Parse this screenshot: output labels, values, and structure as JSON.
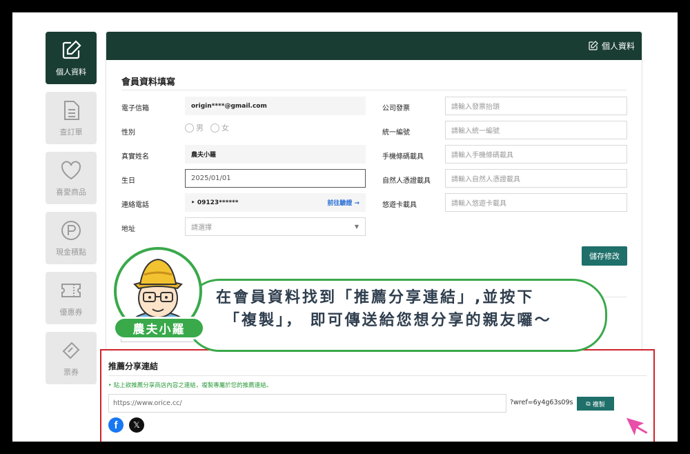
{
  "sidebar": {
    "items": [
      {
        "label": "個人資料",
        "icon": "edit-icon",
        "active": true
      },
      {
        "label": "查訂單",
        "icon": "document-icon",
        "active": false
      },
      {
        "label": "喜愛商品",
        "icon": "heart-icon",
        "active": false
      },
      {
        "label": "現金積點",
        "icon": "points-icon",
        "active": false
      },
      {
        "label": "優惠券",
        "icon": "coupon-icon",
        "active": false
      },
      {
        "label": "票券",
        "icon": "ticket-icon",
        "active": false
      }
    ]
  },
  "header": {
    "title": "個人資料",
    "icon": "edit-icon"
  },
  "form": {
    "section_title": "會員資料填寫",
    "email_label": "電子信箱",
    "email_value": "origin****@gmail.com",
    "gender_label": "性別",
    "gender_options": [
      "男",
      "女"
    ],
    "name_label": "真實姓名",
    "name_value": "農夫小羅",
    "birthday_label": "生日",
    "birthday_value": "2025/01/01",
    "phone_label": "連絡電話",
    "phone_value": "‣ 09123******",
    "phone_verify": "前往驗證 →",
    "address_label": "地址",
    "address_placeholder": "請選擇",
    "invoice_label": "公司發票",
    "invoice_placeholder": "請輸入發票抬頭",
    "tax_id_label": "統一編號",
    "tax_id_placeholder": "請輸入統一編號",
    "mobile_carrier_label": "手機條碼載具",
    "mobile_carrier_placeholder": "請輸入手機條碼載具",
    "citizen_carrier_label": "自然人憑證載具",
    "citizen_carrier_placeholder": "請輸入自然人憑證載具",
    "easycard_label": "悠遊卡載具",
    "easycard_placeholder": "請輸入悠遊卡載具",
    "save_label": "儲存修改"
  },
  "referral": {
    "title": "推薦分享連結",
    "hint": "‣  貼上欲推薦分享商店內容之連結，複製專屬於您的推薦連結。",
    "url_placeholder": "https://www.orice.cc/",
    "suffix": "?wref=6y4g63s09s",
    "copy_label": "複製",
    "share_icons": [
      "facebook-icon",
      "x-icon"
    ]
  },
  "callout": {
    "line1": "在會員資料找到「推薦分享連結」,並按下",
    "line2": "「複製」， 即可傳送給您想分享的親友囉～",
    "name": "農夫小羅"
  },
  "colors": {
    "dark_green": "#1a3d33",
    "teal": "#1f6f6a",
    "highlight_red": "#d0222a",
    "bubble_green": "#39a94a"
  }
}
